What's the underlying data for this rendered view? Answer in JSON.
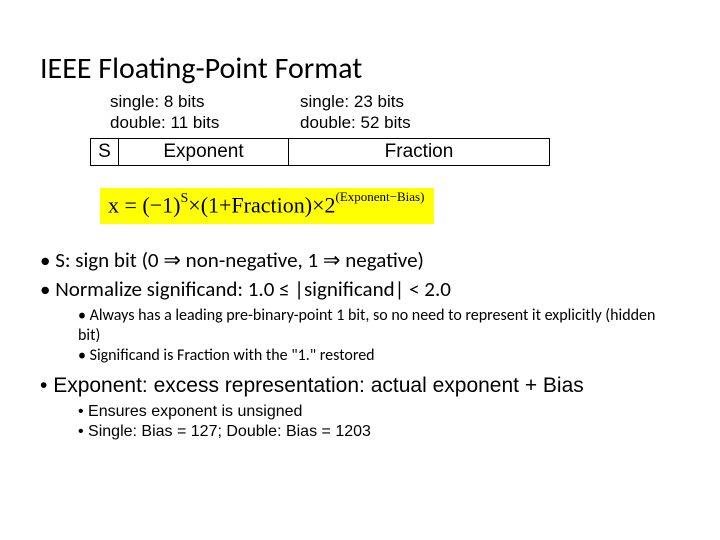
{
  "title": "IEEE Floating-Point Format",
  "bits": {
    "exp_single": "single: 8 bits",
    "exp_double": "double: 11 bits",
    "frac_single": "single: 23 bits",
    "frac_double": "double: 52 bits"
  },
  "fields": {
    "s": "S",
    "exponent": "Exponent",
    "fraction": "Fraction"
  },
  "formula": {
    "lhs": "x",
    "base1": "(−1)",
    "sup1": "S",
    "mid": "×(1+Fraction)×2",
    "sup2": "(Exponent−Bias)"
  },
  "bullets": {
    "b1a": "S: sign bit (0 ",
    "b1b": " non-negative, 1 ",
    "b1c": " negative)",
    "b2": "Normalize significand: 1.0 ≤ |significand| < 2.0",
    "b2_1": "Always has a leading pre-binary-point 1 bit, so no need to represent it explicitly (hidden bit)",
    "b2_2": "Significand is Fraction with the \"1.\" restored",
    "b3": "Exponent: excess representation: actual exponent + Bias",
    "b3_1": "Ensures exponent is unsigned",
    "b3_2": "Single: Bias = 127; Double: Bias = 1203"
  },
  "glyphs": {
    "arrow": "⇒"
  }
}
